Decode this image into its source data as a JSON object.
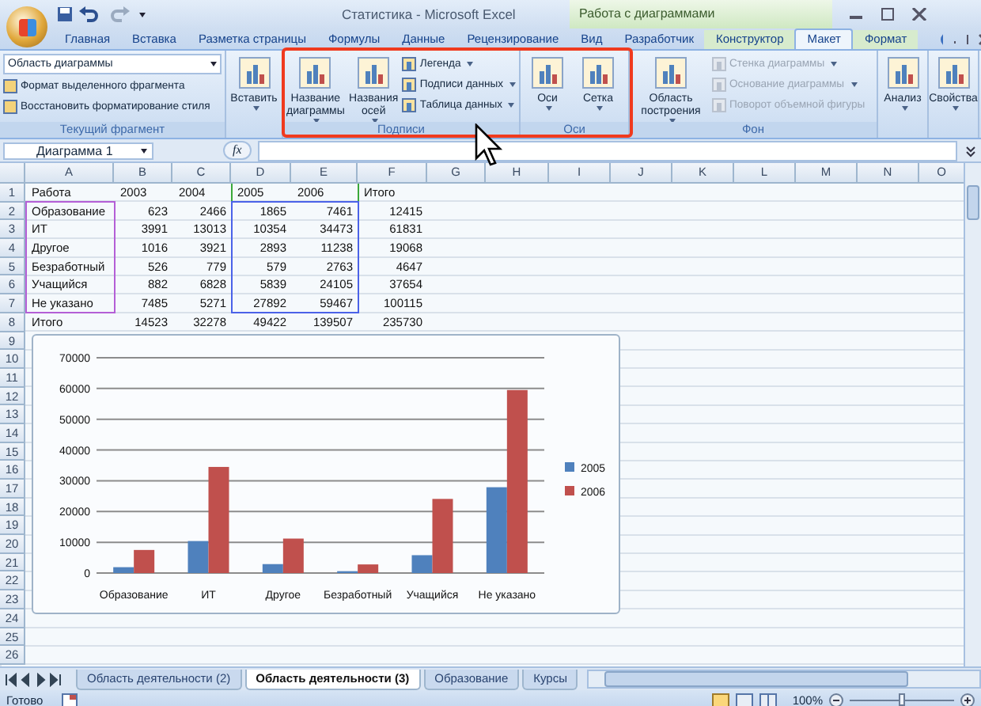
{
  "window": {
    "title": "Статистика - Microsoft Excel",
    "context_title": "Работа с диаграммами"
  },
  "tabs": [
    {
      "label": "Главная",
      "selected": false,
      "contextual": false
    },
    {
      "label": "Вставка",
      "selected": false,
      "contextual": false
    },
    {
      "label": "Разметка страницы",
      "selected": false,
      "contextual": false
    },
    {
      "label": "Формулы",
      "selected": false,
      "contextual": false
    },
    {
      "label": "Данные",
      "selected": false,
      "contextual": false
    },
    {
      "label": "Рецензирование",
      "selected": false,
      "contextual": false
    },
    {
      "label": "Вид",
      "selected": false,
      "contextual": false
    },
    {
      "label": "Разработчик",
      "selected": false,
      "contextual": false
    },
    {
      "label": "Конструктор",
      "selected": false,
      "contextual": true
    },
    {
      "label": "Макет",
      "selected": true,
      "contextual": true
    },
    {
      "label": "Формат",
      "selected": false,
      "contextual": true
    }
  ],
  "ribbon": {
    "groups": [
      {
        "kind": "selection",
        "label": "Текущий фрагмент",
        "dropdown": "Область диаграммы",
        "items": [
          "Формат выделенного фрагмента",
          "Восстановить форматирование стиля"
        ]
      },
      {
        "kind": "insert",
        "big_buttons": [
          "Вставить"
        ]
      },
      {
        "kind": "labels",
        "label": "Подписи",
        "big_buttons": [
          "Название диаграммы",
          "Названия осей"
        ],
        "small_buttons": [
          {
            "label": "Легенда",
            "disabled": false
          },
          {
            "label": "Подписи данных",
            "disabled": false
          },
          {
            "label": "Таблица данных",
            "disabled": false
          }
        ]
      },
      {
        "kind": "axes",
        "label": "Оси",
        "big_buttons": [
          "Оси",
          "Сетка"
        ]
      },
      {
        "kind": "background",
        "label": "Фон",
        "big_buttons": [
          "Область построения"
        ],
        "small_buttons": [
          {
            "label": "Стенка диаграммы",
            "disabled": true
          },
          {
            "label": "Основание диаграммы",
            "disabled": true
          },
          {
            "label": "Поворот объемной фигуры",
            "disabled": true
          }
        ]
      },
      {
        "kind": "single",
        "big_buttons": [
          "Анализ"
        ]
      },
      {
        "kind": "single",
        "big_buttons": [
          "Свойства"
        ]
      }
    ]
  },
  "formula_bar": {
    "name_box": "Диаграмма 1",
    "function_label": "fx"
  },
  "sheet": {
    "columns": [
      "A",
      "B",
      "C",
      "D",
      "E",
      "F",
      "G",
      "H",
      "I",
      "J",
      "K",
      "L",
      "M",
      "N",
      "O"
    ],
    "rows": [
      {
        "number": "1",
        "cells": [
          "Работа",
          "2003",
          "2004",
          "2005",
          "2006",
          "Итого"
        ]
      },
      {
        "number": "2",
        "cells": [
          "Образование",
          "623",
          "2466",
          "1865",
          "7461",
          "12415"
        ]
      },
      {
        "number": "3",
        "cells": [
          "ИТ",
          "3991",
          "13013",
          "10354",
          "34473",
          "61831"
        ]
      },
      {
        "number": "4",
        "cells": [
          "Другое",
          "1016",
          "3921",
          "2893",
          "11238",
          "19068"
        ]
      },
      {
        "number": "5",
        "cells": [
          "Безработный",
          "526",
          "779",
          "579",
          "2763",
          "4647"
        ]
      },
      {
        "number": "6",
        "cells": [
          "Учащийся",
          "882",
          "6828",
          "5839",
          "24105",
          "37654"
        ]
      },
      {
        "number": "7",
        "cells": [
          "Не указано",
          "7485",
          "5271",
          "27892",
          "59467",
          "100115"
        ]
      },
      {
        "number": "8",
        "cells": [
          "Итого",
          "14523",
          "32278",
          "49422",
          "139507",
          "235730"
        ]
      },
      {
        "number": "9"
      },
      {
        "number": "10"
      },
      {
        "number": "11"
      },
      {
        "number": "12"
      },
      {
        "number": "13"
      },
      {
        "number": "14"
      },
      {
        "number": "15"
      },
      {
        "number": "16"
      },
      {
        "number": "17"
      },
      {
        "number": "18"
      },
      {
        "number": "19"
      },
      {
        "number": "20"
      },
      {
        "number": "21"
      },
      {
        "number": "22"
      },
      {
        "number": "23"
      },
      {
        "number": "24"
      },
      {
        "number": "25"
      },
      {
        "number": "26"
      }
    ]
  },
  "chart": {
    "chart_data": {
      "type": "bar",
      "categories": [
        "Образование",
        "ИТ",
        "Другое",
        "Безработный",
        "Учащийся",
        "Не указано"
      ],
      "series": [
        {
          "name": "2005",
          "color": "#4f81bd",
          "values": [
            1900,
            10400,
            2900,
            600,
            5800,
            27900
          ]
        },
        {
          "name": "2006",
          "color": "#c0504d",
          "values": [
            7500,
            34500,
            11200,
            2800,
            24100,
            59500
          ]
        }
      ],
      "grid": true,
      "legend": "right",
      "ylim": [
        0,
        70000
      ],
      "yticks": [
        0,
        10000,
        20000,
        30000,
        40000,
        50000,
        60000,
        70000
      ]
    }
  },
  "sheet_tabs": [
    {
      "label": "Область деятельности (2)",
      "selected": false
    },
    {
      "label": "Область деятельности (3)",
      "selected": true
    },
    {
      "label": "Образование",
      "selected": false
    },
    {
      "label": "Курсы",
      "selected": false
    }
  ],
  "status_bar": {
    "status": "Готово",
    "zoom": "100%",
    "zoom_slider": {
      "level": 0.5
    }
  }
}
